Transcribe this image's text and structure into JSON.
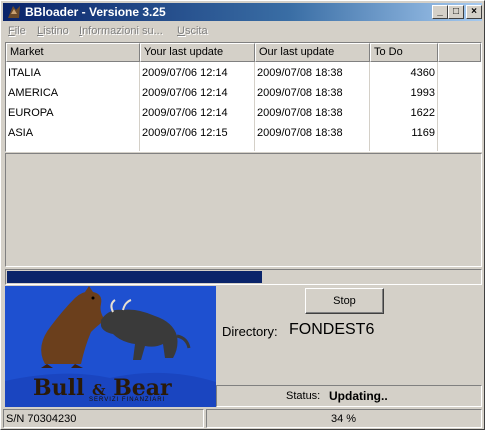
{
  "window": {
    "title": "BBloader - Versione 3.25",
    "buttons": {
      "minimize": "_",
      "maximize": "□",
      "close": "×"
    }
  },
  "menu": [
    {
      "label": "File",
      "accel": "F",
      "rest": "ile"
    },
    {
      "label": "Listino",
      "accel": "L",
      "rest": "istino"
    },
    {
      "label": "Informazioni su...",
      "accel": "I",
      "rest": "nformazioni su..."
    },
    {
      "label": "Uscita",
      "accel": "U",
      "rest": "scita"
    }
  ],
  "table": {
    "columns": [
      "Market",
      "Your last update",
      "Our last update",
      "To Do"
    ],
    "rows": [
      {
        "market": "ITALIA",
        "your_last": "2009/07/06 12:14",
        "our_last": "2009/07/08 18:38",
        "todo": "4360"
      },
      {
        "market": "AMERICA",
        "your_last": "2009/07/06 12:14",
        "our_last": "2009/07/08 18:38",
        "todo": "1993"
      },
      {
        "market": "EUROPA",
        "your_last": "2009/07/06 12:14",
        "our_last": "2009/07/08 18:38",
        "todo": "1622"
      },
      {
        "market": "ASIA",
        "your_last": "2009/07/06 12:15",
        "our_last": "2009/07/08 18:38",
        "todo": "1169"
      }
    ]
  },
  "progress": {
    "fraction": 0.54
  },
  "logo": {
    "brand_left": "Bull",
    "amp": "&",
    "brand_right": "Bear",
    "subtitle": "SERVIZI FINANZIARI"
  },
  "actions": {
    "stop_label": "Stop"
  },
  "directory": {
    "label": "Directory:",
    "value": "FONDEST6"
  },
  "status": {
    "label": "Status:",
    "value": "Updating.."
  },
  "statusbar": {
    "serial": "S/N  70304230",
    "percent": "34 %"
  },
  "colors": {
    "titlebar": "#0a246a",
    "progress": "#0a246a",
    "logo_bg": "#1e50d0"
  }
}
